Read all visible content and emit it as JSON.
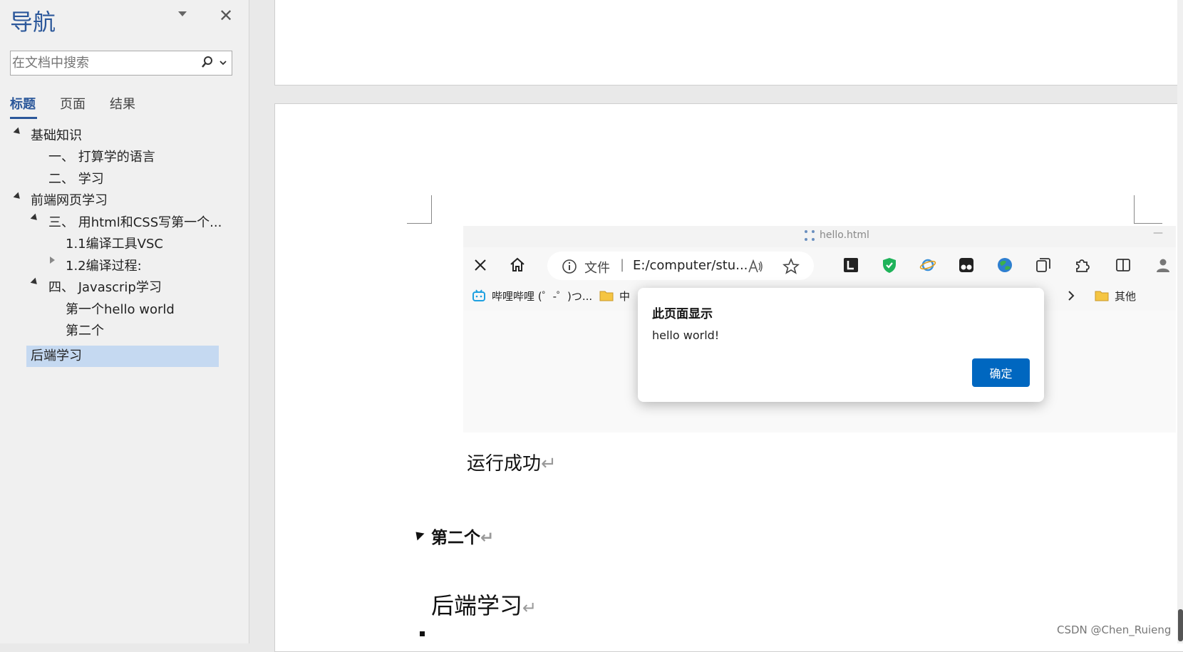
{
  "nav": {
    "title": "导航",
    "search_placeholder": "在文档中搜索",
    "tabs": [
      {
        "label": "标题",
        "active": true
      },
      {
        "label": "页面",
        "active": false
      },
      {
        "label": "结果",
        "active": false
      }
    ],
    "tree": [
      {
        "label": "基础知识",
        "level": 0,
        "expanded": true
      },
      {
        "label": "一、 打算学的语言",
        "level": 1
      },
      {
        "label": "二、 学习",
        "level": 1
      },
      {
        "label": "前端网页学习",
        "level": 0,
        "expanded": true
      },
      {
        "label": "三、 用html和CSS写第一个...",
        "level": 1,
        "expanded": true
      },
      {
        "label": "1.1编译工具VSC",
        "level": 2
      },
      {
        "label": "1.2编译过程:",
        "level": 2,
        "expanded": false
      },
      {
        "label": "四、 Javascrip学习",
        "level": 1,
        "expanded": true
      },
      {
        "label": "第一个hello world",
        "level": 2
      },
      {
        "label": "第二个",
        "level": 2
      },
      {
        "label": "后端学习",
        "level": 0,
        "selected": true
      }
    ]
  },
  "browser": {
    "tab_title": "hello.html",
    "address_scheme": "文件",
    "address_separator": "|",
    "address_url": "E:/computer/stu...",
    "favorites": [
      {
        "label": "哔哩哔哩 (゜-゜)つ...",
        "icon": "bilibili-icon"
      },
      {
        "label": "中",
        "icon": "folder-icon"
      },
      {
        "label": "其他",
        "icon": "folder-icon"
      }
    ],
    "minimize_glyph": "—"
  },
  "alert": {
    "title": "此页面显示",
    "message": "hello world!",
    "ok_label": "确定"
  },
  "document": {
    "run_success": "运行成功",
    "heading_second": "第二个",
    "heading_backend": "后端学习",
    "paragraph_mark": "↵"
  },
  "watermark": "CSDN @Chen_Ruieng",
  "colors": {
    "accent_blue": "#2b579a",
    "selection": "#c5d9f1",
    "ok_button": "#0067c0"
  }
}
